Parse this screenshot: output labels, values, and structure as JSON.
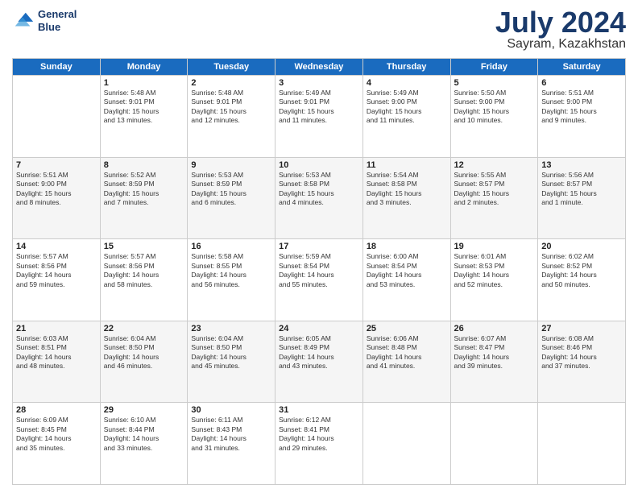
{
  "logo": {
    "line1": "General",
    "line2": "Blue"
  },
  "title": "July 2024",
  "location": "Sayram, Kazakhstan",
  "days": [
    "Sunday",
    "Monday",
    "Tuesday",
    "Wednesday",
    "Thursday",
    "Friday",
    "Saturday"
  ],
  "weeks": [
    [
      {
        "date": "",
        "info": ""
      },
      {
        "date": "1",
        "info": "Sunrise: 5:48 AM\nSunset: 9:01 PM\nDaylight: 15 hours\nand 13 minutes."
      },
      {
        "date": "2",
        "info": "Sunrise: 5:48 AM\nSunset: 9:01 PM\nDaylight: 15 hours\nand 12 minutes."
      },
      {
        "date": "3",
        "info": "Sunrise: 5:49 AM\nSunset: 9:01 PM\nDaylight: 15 hours\nand 11 minutes."
      },
      {
        "date": "4",
        "info": "Sunrise: 5:49 AM\nSunset: 9:00 PM\nDaylight: 15 hours\nand 11 minutes."
      },
      {
        "date": "5",
        "info": "Sunrise: 5:50 AM\nSunset: 9:00 PM\nDaylight: 15 hours\nand 10 minutes."
      },
      {
        "date": "6",
        "info": "Sunrise: 5:51 AM\nSunset: 9:00 PM\nDaylight: 15 hours\nand 9 minutes."
      }
    ],
    [
      {
        "date": "7",
        "info": "Sunrise: 5:51 AM\nSunset: 9:00 PM\nDaylight: 15 hours\nand 8 minutes."
      },
      {
        "date": "8",
        "info": "Sunrise: 5:52 AM\nSunset: 8:59 PM\nDaylight: 15 hours\nand 7 minutes."
      },
      {
        "date": "9",
        "info": "Sunrise: 5:53 AM\nSunset: 8:59 PM\nDaylight: 15 hours\nand 6 minutes."
      },
      {
        "date": "10",
        "info": "Sunrise: 5:53 AM\nSunset: 8:58 PM\nDaylight: 15 hours\nand 4 minutes."
      },
      {
        "date": "11",
        "info": "Sunrise: 5:54 AM\nSunset: 8:58 PM\nDaylight: 15 hours\nand 3 minutes."
      },
      {
        "date": "12",
        "info": "Sunrise: 5:55 AM\nSunset: 8:57 PM\nDaylight: 15 hours\nand 2 minutes."
      },
      {
        "date": "13",
        "info": "Sunrise: 5:56 AM\nSunset: 8:57 PM\nDaylight: 15 hours\nand 1 minute."
      }
    ],
    [
      {
        "date": "14",
        "info": "Sunrise: 5:57 AM\nSunset: 8:56 PM\nDaylight: 14 hours\nand 59 minutes."
      },
      {
        "date": "15",
        "info": "Sunrise: 5:57 AM\nSunset: 8:56 PM\nDaylight: 14 hours\nand 58 minutes."
      },
      {
        "date": "16",
        "info": "Sunrise: 5:58 AM\nSunset: 8:55 PM\nDaylight: 14 hours\nand 56 minutes."
      },
      {
        "date": "17",
        "info": "Sunrise: 5:59 AM\nSunset: 8:54 PM\nDaylight: 14 hours\nand 55 minutes."
      },
      {
        "date": "18",
        "info": "Sunrise: 6:00 AM\nSunset: 8:54 PM\nDaylight: 14 hours\nand 53 minutes."
      },
      {
        "date": "19",
        "info": "Sunrise: 6:01 AM\nSunset: 8:53 PM\nDaylight: 14 hours\nand 52 minutes."
      },
      {
        "date": "20",
        "info": "Sunrise: 6:02 AM\nSunset: 8:52 PM\nDaylight: 14 hours\nand 50 minutes."
      }
    ],
    [
      {
        "date": "21",
        "info": "Sunrise: 6:03 AM\nSunset: 8:51 PM\nDaylight: 14 hours\nand 48 minutes."
      },
      {
        "date": "22",
        "info": "Sunrise: 6:04 AM\nSunset: 8:50 PM\nDaylight: 14 hours\nand 46 minutes."
      },
      {
        "date": "23",
        "info": "Sunrise: 6:04 AM\nSunset: 8:50 PM\nDaylight: 14 hours\nand 45 minutes."
      },
      {
        "date": "24",
        "info": "Sunrise: 6:05 AM\nSunset: 8:49 PM\nDaylight: 14 hours\nand 43 minutes."
      },
      {
        "date": "25",
        "info": "Sunrise: 6:06 AM\nSunset: 8:48 PM\nDaylight: 14 hours\nand 41 minutes."
      },
      {
        "date": "26",
        "info": "Sunrise: 6:07 AM\nSunset: 8:47 PM\nDaylight: 14 hours\nand 39 minutes."
      },
      {
        "date": "27",
        "info": "Sunrise: 6:08 AM\nSunset: 8:46 PM\nDaylight: 14 hours\nand 37 minutes."
      }
    ],
    [
      {
        "date": "28",
        "info": "Sunrise: 6:09 AM\nSunset: 8:45 PM\nDaylight: 14 hours\nand 35 minutes."
      },
      {
        "date": "29",
        "info": "Sunrise: 6:10 AM\nSunset: 8:44 PM\nDaylight: 14 hours\nand 33 minutes."
      },
      {
        "date": "30",
        "info": "Sunrise: 6:11 AM\nSunset: 8:43 PM\nDaylight: 14 hours\nand 31 minutes."
      },
      {
        "date": "31",
        "info": "Sunrise: 6:12 AM\nSunset: 8:41 PM\nDaylight: 14 hours\nand 29 minutes."
      },
      {
        "date": "",
        "info": ""
      },
      {
        "date": "",
        "info": ""
      },
      {
        "date": "",
        "info": ""
      }
    ]
  ]
}
